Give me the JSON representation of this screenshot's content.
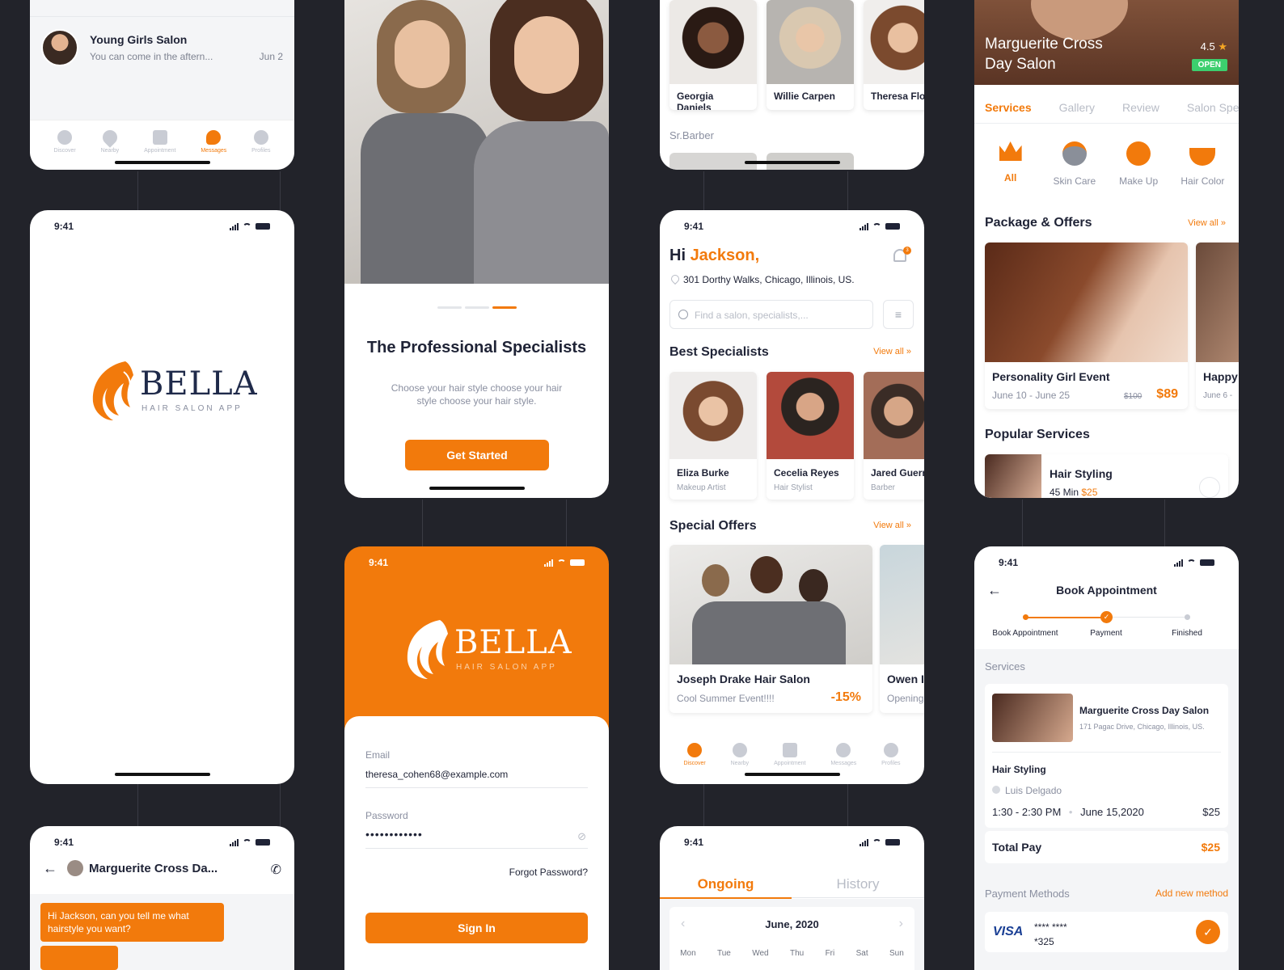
{
  "status_time": "9:41",
  "messages": {
    "name": "Young Girls Salon",
    "preview": "You can come in the aftern...",
    "date": "Jun 2",
    "nav": [
      "Discover",
      "Nearby",
      "Appointment",
      "Messages",
      "Profiles"
    ]
  },
  "splash": {
    "brand": "BELLA",
    "tagline": "HAIR SALON APP"
  },
  "onboarding": {
    "title": "The Professional Specialists",
    "desc": "Choose your hair style choose your hair style choose your hair style.",
    "button": "Get Started"
  },
  "login": {
    "brand": "BELLA",
    "tagline": "HAIR SALON APP",
    "email_label": "Email",
    "email_value": "theresa_cohen68@example.com",
    "password_label": "Password",
    "password_value": "••••••••••••",
    "forgot": "Forgot Password?",
    "button": "Sign In"
  },
  "chat": {
    "name": "Marguerite Cross Da...",
    "bubble": "Hi Jackson, can you tell me what hairstyle you want?"
  },
  "topstylists": {
    "names": [
      "Georgia Daniels",
      "Willie Carpen",
      "Theresa Flo"
    ],
    "section": "Sr.Barber"
  },
  "home": {
    "hi": "Hi",
    "name": "Jackson,",
    "notif": "3",
    "address": "301 Dorthy Walks, Chicago, Illinois, US.",
    "search_placeholder": "Find a salon, specialists,...",
    "specialists_title": "Best Specialists",
    "view_all": "View all »",
    "specialists": [
      {
        "name": "Eliza Burke",
        "role": "Makeup Artist"
      },
      {
        "name": "Cecelia Reyes",
        "role": "Hair Stylist"
      },
      {
        "name": "Jared Guerr",
        "role": "Barber"
      }
    ],
    "offers_title": "Special Offers",
    "offers": [
      {
        "name": "Joseph Drake Hair Salon",
        "desc": "Cool Summer Event!!!!",
        "discount": "-15%"
      },
      {
        "name": "Owen I",
        "desc": "Opening"
      }
    ],
    "nav": [
      "Discover",
      "Nearby",
      "Appointment",
      "Messages",
      "Profiles"
    ]
  },
  "history": {
    "tabs": [
      "Ongoing",
      "History"
    ],
    "month": "June, 2020",
    "days": [
      "Mon",
      "Tue",
      "Wed",
      "Thu",
      "Fri",
      "Sat",
      "Sun"
    ]
  },
  "salon": {
    "name": "Marguerite Cross Day Salon",
    "rating": "4.5",
    "open": "OPEN",
    "tabs": [
      "Services",
      "Gallery",
      "Review",
      "Salon Spe"
    ],
    "categories": [
      "All",
      "Skin Care",
      "Make Up",
      "Hair Color"
    ],
    "package_title": "Package & Offers",
    "view_all": "View all »",
    "packages": [
      {
        "name": "Personality Girl Event",
        "dates": "June 10 - June 25",
        "old": "$100",
        "price": "$89"
      },
      {
        "name": "Happy",
        "dates": "June 6 -"
      }
    ],
    "popular_title": "Popular Services",
    "service_name": "Hair Styling",
    "service_meta": "45 Min",
    "service_price": "$25"
  },
  "booking": {
    "title": "Book Appointment",
    "steps": [
      "Book Appointment",
      "Payment",
      "Finished"
    ],
    "services_label": "Services",
    "salon_name": "Marguerite Cross Day Salon",
    "salon_addr": "171 Pagac Drive, Chicago, Illinois, US.",
    "service": "Hair Styling",
    "stylist": "Luis Delgado",
    "time": "1:30 - 2:30 PM",
    "date": "June 15,2020",
    "price": "$25",
    "total_label": "Total Pay",
    "total": "$25",
    "pm_label": "Payment Methods",
    "add_method": "Add new method",
    "card_brand": "VISA",
    "card_mask": "**** ****",
    "card_last": "*325"
  },
  "colors": {
    "accent": "#f27a0c",
    "bg": "#22232a",
    "text": "#1f2336"
  }
}
